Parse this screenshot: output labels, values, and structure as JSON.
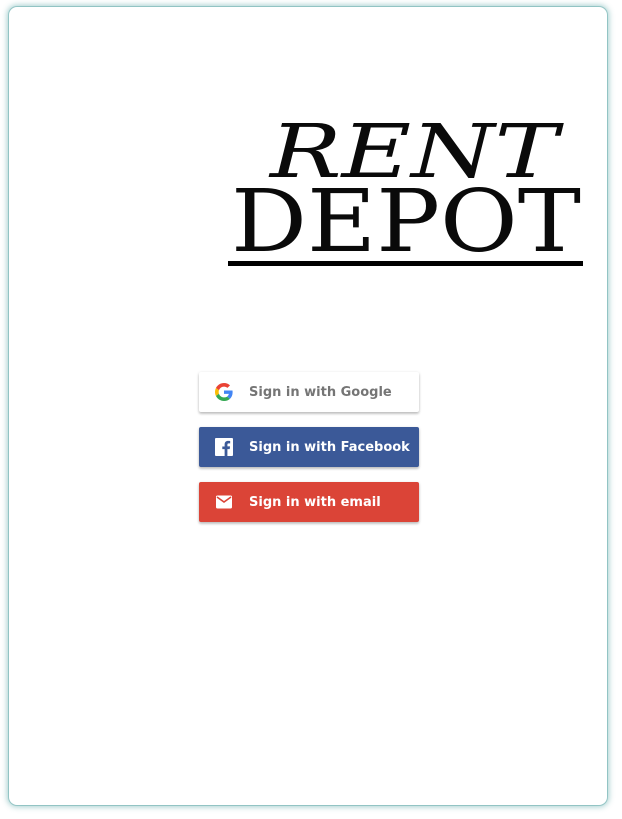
{
  "logo": {
    "line1": "RENT",
    "line2": "DEPOT"
  },
  "auth": {
    "google_label": "Sign in with Google",
    "facebook_label": "Sign in with Facebook",
    "email_label": "Sign in with email"
  },
  "colors": {
    "google_bg": "#ffffff",
    "facebook_bg": "#3b5998",
    "email_bg": "#db4437",
    "frame_glow": "#3c9696"
  },
  "icons": {
    "google": "google-g-icon",
    "facebook": "facebook-f-icon",
    "email": "envelope-icon"
  }
}
